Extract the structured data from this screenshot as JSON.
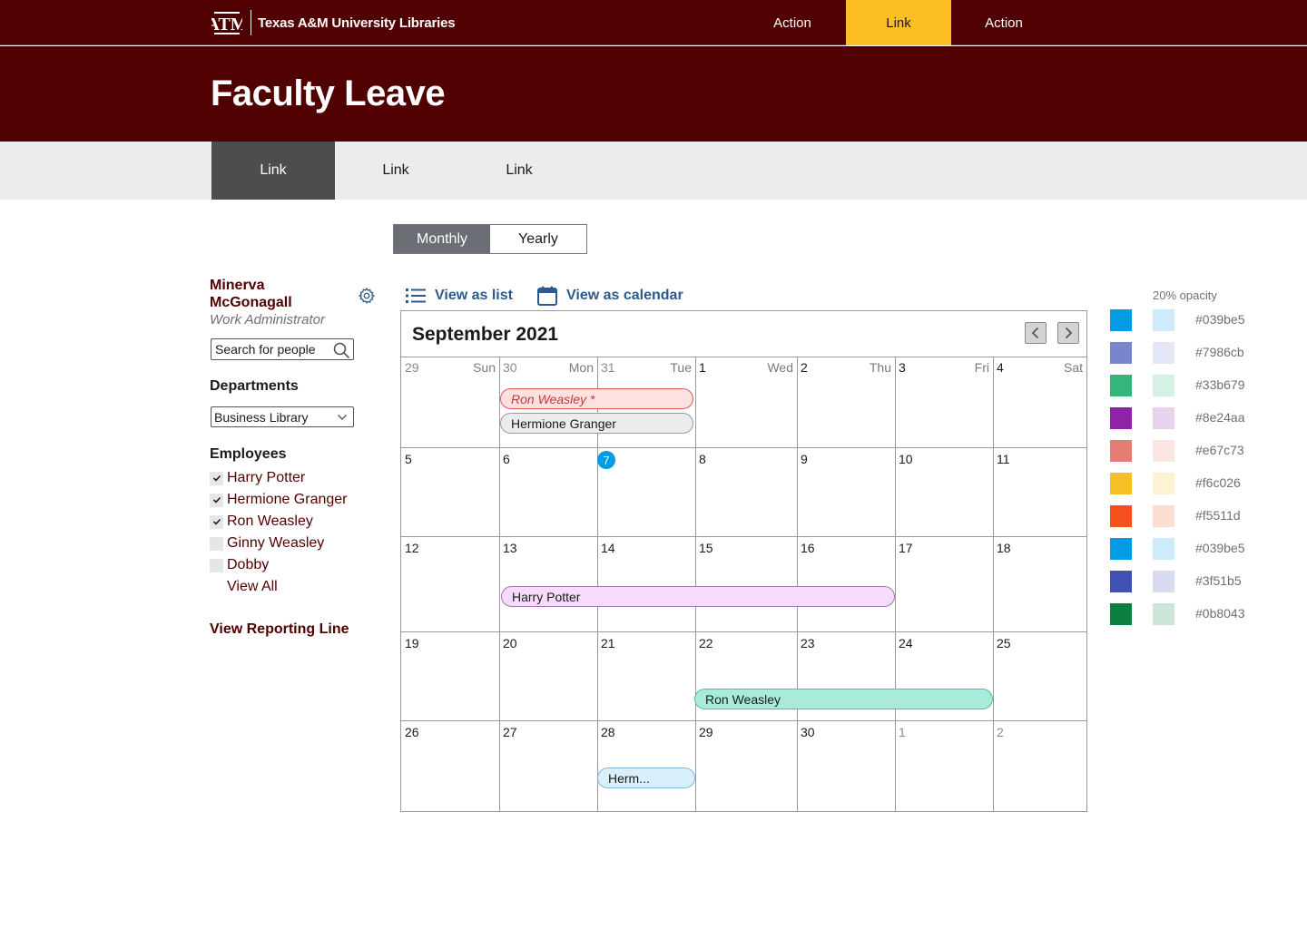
{
  "topbar": {
    "logo_text": "Texas A&M University Libraries",
    "nav": [
      "Action",
      "Link",
      "Action"
    ]
  },
  "page": {
    "title": "Faculty Leave"
  },
  "subnav": [
    "Link",
    "Link",
    "Link"
  ],
  "view_toggle": {
    "monthly": "Monthly",
    "yearly": "Yearly",
    "selected": "Monthly"
  },
  "sidebar": {
    "user_name": "Minerva McGonagall",
    "user_role": "Work Administrator",
    "search_placeholder": "Search for people",
    "departments_heading": "Departments",
    "department_selected": "Business Library",
    "employees_heading": "Employees",
    "employees": [
      {
        "name": "Harry Potter",
        "checked": true
      },
      {
        "name": "Hermione Granger",
        "checked": true
      },
      {
        "name": "Ron Weasley",
        "checked": true
      },
      {
        "name": "Ginny Weasley",
        "checked": false
      },
      {
        "name": "Dobby",
        "checked": false
      }
    ],
    "view_all": "View All",
    "reporting_line": "View Reporting Line"
  },
  "views": {
    "list": "View as list",
    "calendar": "View as calendar"
  },
  "calendar": {
    "title": "September 2021",
    "weekdays": [
      "Sun",
      "Mon",
      "Tue",
      "Wed",
      "Thu",
      "Fri",
      "Sat"
    ],
    "weeks": [
      [
        "29",
        "30",
        "31",
        "1",
        "2",
        "3",
        "4"
      ],
      [
        "5",
        "6",
        "7",
        "8",
        "9",
        "10",
        "11"
      ],
      [
        "12",
        "13",
        "14",
        "15",
        "16",
        "17",
        "18"
      ],
      [
        "19",
        "20",
        "21",
        "22",
        "23",
        "24",
        "25"
      ],
      [
        "26",
        "27",
        "28",
        "29",
        "30",
        "1",
        "2"
      ]
    ],
    "today": "7",
    "events": [
      {
        "label": "Ron Weasley *",
        "style": "red"
      },
      {
        "label": "Hermione Granger",
        "style": "grey"
      },
      {
        "label": "Harry Potter",
        "style": "purple"
      },
      {
        "label": "Ron Weasley",
        "style": "teal"
      },
      {
        "label": "Herm...",
        "style": "blue"
      }
    ]
  },
  "color_key": {
    "label": "20% opacity",
    "colors": [
      "#039be5",
      "#7986cb",
      "#33b679",
      "#8e24aa",
      "#e67c73",
      "#f6c026",
      "#f5511d",
      "#039be5",
      "#3f51b5",
      "#0b8043"
    ]
  }
}
